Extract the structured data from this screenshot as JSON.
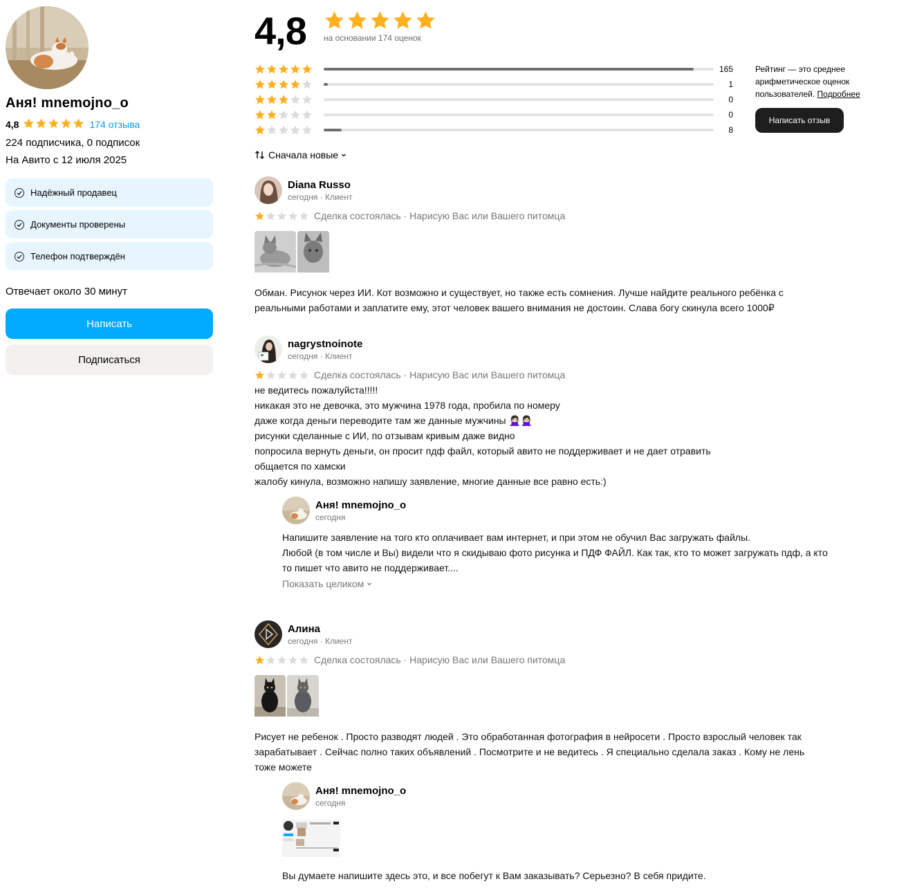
{
  "profile": {
    "name": "Аня! mnemojno_o",
    "rating": "4,8",
    "reviews_link": "174 отзыва",
    "subscribers": "224 подписчика, 0 подписок",
    "since": "На Авито с 12 июля 2025",
    "badges": [
      "Надёжный продавец",
      "Документы проверены",
      "Телефон подтверждён"
    ],
    "responds": "Отвечает около 30 минут",
    "write_button": "Написать",
    "subscribe_button": "Подписаться"
  },
  "summary": {
    "rating": "4,8",
    "based_on": "на основании 174 оценок",
    "distribution": [
      {
        "stars": 5,
        "count": "165",
        "fraction": 0.948
      },
      {
        "stars": 4,
        "count": "1",
        "fraction": 0.01
      },
      {
        "stars": 3,
        "count": "0",
        "fraction": 0
      },
      {
        "stars": 2,
        "count": "0",
        "fraction": 0
      },
      {
        "stars": 1,
        "count": "8",
        "fraction": 0.046
      }
    ],
    "info_text": "Рейтинг — это среднее арифметическое оценок пользователей.",
    "info_link": "Подробнее",
    "write_review_button": "Написать отзыв"
  },
  "sort": {
    "label": "Сначала новые"
  },
  "colors": {
    "accent": "#00aaff",
    "star": "#ffb021",
    "star_empty": "#dcdcdc"
  },
  "reviews": [
    {
      "author": "Diana Russo",
      "meta": "сегодня · Клиент",
      "stars": 1,
      "deal": "Сделка состоялась · Нарисую Вас или Вашего питомца",
      "text_lines": [
        "Обман. Рисунок через ИИ. Кот возможно и существует, но также есть сомнения. Лучше найдите реального ребёнка с",
        "реальными работами и заплатите ему, этот человек вашего внимания не достоин. Слава богу скинула всего 1000₽"
      ]
    },
    {
      "author": "nagrystnoinote",
      "meta": "сегодня · Клиент",
      "stars": 1,
      "deal": "Сделка состоялась · Нарисую Вас или Вашего питомца",
      "text_lines": [
        "не ведитесь пожалуйста!!!!!",
        "никакая это не девочка, это мужчина 1978 года, пробила по номеру",
        "даже когда деньги переводите там же данные мужчины 🙅🏻‍♀️🙅🏻‍♀️",
        "рисунки сделанные с ИИ, по отзывам кривым даже видно",
        "попросила вернуть деньги, он просит пдф файл, который авито не поддерживает и не дает отравить",
        "общается по хамски",
        "жалобу кинула, возможно напишу заявление, многие данные все равно есть:)"
      ],
      "reply": {
        "author": "Аня! mnemojno_o",
        "meta": "сегодня",
        "text_lines": [
          "Напишите заявление на того кто оплачивает вам интернет, и при этом не обучил Вас загружать файлы.",
          "Любой (в том числе и Вы) видели что я скидываю фото рисунка и ПДФ ФАЙЛ. Как так, кто то может загружать пдф, а кто",
          "то пишет что авито не поддерживает...."
        ],
        "show_full": "Показать целиком"
      }
    },
    {
      "author": "Алина",
      "meta": "сегодня · Клиент",
      "stars": 1,
      "deal": "Сделка состоялась · Нарисую Вас или Вашего питомца",
      "text_lines": [
        "Рисует не ребенок . Просто разводят людей . Это обработанная фотография в нейросети . Просто взрослый человек так",
        "зарабатывает . Сейчас полно таких объявлений . Посмотрите и не ведитесь . Я специально сделала заказ . Кому не лень",
        "тоже можете"
      ],
      "reply": {
        "author": "Аня! mnemojno_o",
        "meta": "сегодня",
        "text_lines": [
          "Вы думаете напишите здесь это, и все побегут к Вам заказывать? Серьезно? В себя придите."
        ]
      }
    }
  ]
}
